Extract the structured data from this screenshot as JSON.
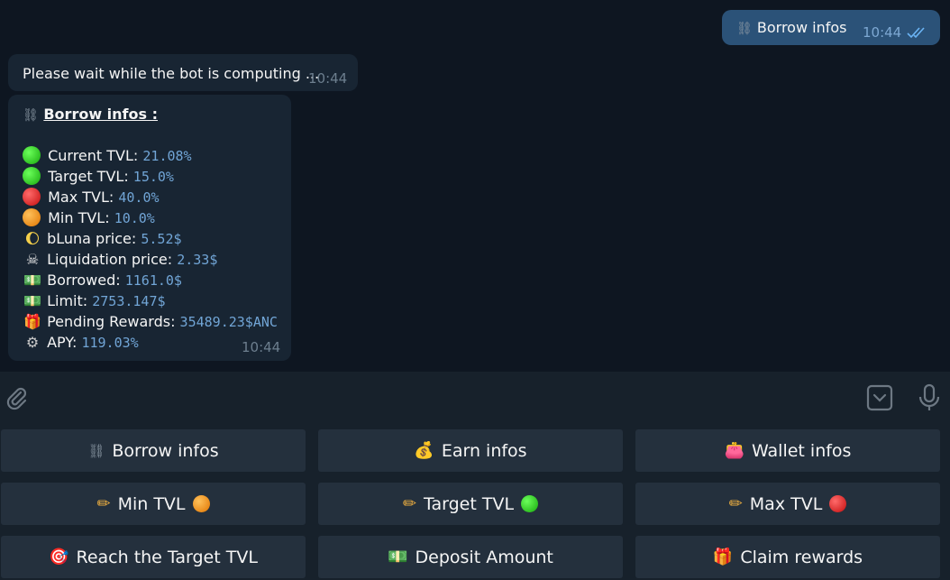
{
  "messages": {
    "outgoing": {
      "icon": "chains-icon",
      "text": "Borrow infos",
      "time": "10:44"
    },
    "wait": {
      "text": "Please wait while the bot is computing ...",
      "time": "10:44"
    },
    "borrow_report": {
      "title": "Borrow infos :",
      "time": "10:44",
      "rows": [
        {
          "label": "Current TVL:",
          "value": "21.08%",
          "icon": "green-circle"
        },
        {
          "label": "Target TVL:",
          "value": "15.0%",
          "icon": "green-circle"
        },
        {
          "label": "Max TVL:",
          "value": "40.0%",
          "icon": "red-circle"
        },
        {
          "label": "Min TVL:",
          "value": "10.0%",
          "icon": "orange-circle"
        },
        {
          "label": "bLuna price:",
          "value": "5.52$",
          "icon": "moon"
        },
        {
          "label": "Liquidation price:",
          "value": "2.33$",
          "icon": "skull-crossbones"
        },
        {
          "label": "Borrowed:",
          "value": "1161.0$",
          "icon": "dollar-banknote"
        },
        {
          "label": "Limit:",
          "value": "2753.147$",
          "icon": "dollar-banknote"
        },
        {
          "label": "Pending Rewards:",
          "value": "35489.23$ANC",
          "icon": "gift"
        },
        {
          "label": "APY:",
          "value": "119.03%",
          "icon": "gear"
        }
      ]
    }
  },
  "keyboard": [
    {
      "label": "Borrow infos",
      "icon": "chains"
    },
    {
      "label": "Earn infos",
      "icon": "money-bag"
    },
    {
      "label": "Wallet infos",
      "icon": "purse"
    },
    {
      "label": "Min TVL",
      "icon": "pencil",
      "suffix": "orange-circle"
    },
    {
      "label": "Target TVL",
      "icon": "pencil",
      "suffix": "green-circle"
    },
    {
      "label": "Max TVL",
      "icon": "pencil",
      "suffix": "red-circle"
    },
    {
      "label": "Reach the Target TVL",
      "icon": "direct-hit"
    },
    {
      "label": "Deposit Amount",
      "icon": "dollar-banknote"
    },
    {
      "label": "Claim rewards",
      "icon": "gift"
    }
  ]
}
